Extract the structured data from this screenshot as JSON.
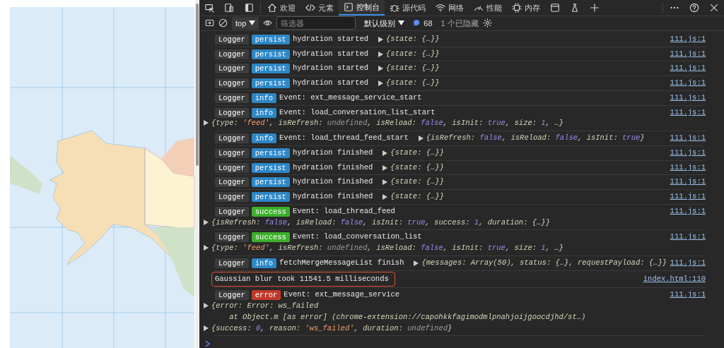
{
  "toolbar": {
    "tools": [
      {
        "kind": "inspect"
      },
      {
        "kind": "device"
      },
      {
        "kind": "dock"
      }
    ],
    "tabs": [
      {
        "kind": "home",
        "label": "欢迎",
        "selected": false
      },
      {
        "kind": "code",
        "label": "元素",
        "selected": false
      },
      {
        "kind": "console",
        "label": "控制台",
        "selected": true
      },
      {
        "kind": "bug",
        "label": "源代码",
        "selected": false
      },
      {
        "kind": "wifi",
        "label": "网络",
        "selected": false
      },
      {
        "kind": "gauge",
        "label": "性能",
        "selected": false
      },
      {
        "kind": "chip",
        "label": "内存",
        "selected": false
      },
      {
        "kind": "window",
        "selected": false
      },
      {
        "kind": "flask",
        "selected": false
      },
      {
        "kind": "plus",
        "selected": false
      }
    ],
    "actions": [
      {
        "kind": "more"
      },
      {
        "kind": "help"
      },
      {
        "kind": "close"
      }
    ]
  },
  "filter_bar": {
    "context": "top",
    "filter_placeholder": "筛选器",
    "level": "默认级别",
    "message_count": "68",
    "hidden": "1 个已隐藏"
  },
  "console": {
    "entries": [
      {
        "badges": [
          {
            "text": "Logger",
            "color": "#3c3c3c"
          },
          {
            "text": "persist",
            "color": "#2d87c6"
          }
        ],
        "message": "hydration started",
        "preview": [
          {
            "text": "{state: {…}}",
            "kind": "key"
          }
        ],
        "source": "111.js:1"
      },
      {
        "badges": [
          {
            "text": "Logger",
            "color": "#3c3c3c"
          },
          {
            "text": "persist",
            "color": "#2d87c6"
          }
        ],
        "message": "hydration started",
        "preview": [
          {
            "text": "{state: {…}}",
            "kind": "key"
          }
        ],
        "source": "111.js:1"
      },
      {
        "badges": [
          {
            "text": "Logger",
            "color": "#3c3c3c"
          },
          {
            "text": "persist",
            "color": "#2d87c6"
          }
        ],
        "message": "hydration started",
        "preview": [
          {
            "text": "{state: {…}}",
            "kind": "key"
          }
        ],
        "source": "111.js:1"
      },
      {
        "badges": [
          {
            "text": "Logger",
            "color": "#3c3c3c"
          },
          {
            "text": "persist",
            "color": "#2d87c6"
          }
        ],
        "message": "hydration started",
        "preview": [
          {
            "text": "{state: {…}}",
            "kind": "key"
          }
        ],
        "source": "111.js:1"
      },
      {
        "badges": [
          {
            "text": "Logger",
            "color": "#3c3c3c"
          },
          {
            "text": "info",
            "color": "#2d87c6"
          }
        ],
        "message": "Event: ext_message_service_start",
        "source": "111.js:1"
      },
      {
        "badges": [
          {
            "text": "Logger",
            "color": "#3c3c3c"
          },
          {
            "text": "info",
            "color": "#2d87c6"
          }
        ],
        "message": "Event: load_conversation_list_start",
        "details": [
          [
            [
              {
                "text": "{type: ",
                "kind": "key"
              },
              {
                "text": "'feed'",
                "kind": "string"
              },
              {
                "text": ", isRefresh: ",
                "kind": "key"
              },
              {
                "text": "undefined",
                "kind": "undef"
              },
              {
                "text": ", isReload: ",
                "kind": "key"
              },
              {
                "text": "false",
                "kind": "literal"
              },
              {
                "text": ", isInit: ",
                "kind": "key"
              },
              {
                "text": "true",
                "kind": "literal"
              },
              {
                "text": ", size: ",
                "kind": "key"
              },
              {
                "text": "1",
                "kind": "literal"
              },
              {
                "text": ", …}",
                "kind": "key"
              }
            ]
          ]
        ],
        "source": "111.js:1"
      },
      {
        "badges": [
          {
            "text": "Logger",
            "color": "#3c3c3c"
          },
          {
            "text": "info",
            "color": "#2d87c6"
          }
        ],
        "message": "Event: load_thread_feed_start",
        "preview": [
          {
            "text": "{isRefresh: ",
            "kind": "key"
          },
          {
            "text": "false",
            "kind": "literal"
          },
          {
            "text": ", isReload: ",
            "kind": "key"
          },
          {
            "text": "false",
            "kind": "literal"
          },
          {
            "text": ", isInit: ",
            "kind": "key"
          },
          {
            "text": "true",
            "kind": "literal"
          },
          {
            "text": "}",
            "kind": "key"
          }
        ],
        "source": "111.js:1"
      },
      {
        "badges": [
          {
            "text": "Logger",
            "color": "#3c3c3c"
          },
          {
            "text": "persist",
            "color": "#2d87c6"
          }
        ],
        "message": "hydration finished",
        "preview": [
          {
            "text": "{state: {…}}",
            "kind": "key"
          }
        ],
        "source": "111.js:1"
      },
      {
        "badges": [
          {
            "text": "Logger",
            "color": "#3c3c3c"
          },
          {
            "text": "persist",
            "color": "#2d87c6"
          }
        ],
        "message": "hydration finished",
        "preview": [
          {
            "text": "{state: {…}}",
            "kind": "key"
          }
        ],
        "source": "111.js:1"
      },
      {
        "badges": [
          {
            "text": "Logger",
            "color": "#3c3c3c"
          },
          {
            "text": "persist",
            "color": "#2d87c6"
          }
        ],
        "message": "hydration finished",
        "preview": [
          {
            "text": "{state: {…}}",
            "kind": "key"
          }
        ],
        "source": "111.js:1"
      },
      {
        "badges": [
          {
            "text": "Logger",
            "color": "#3c3c3c"
          },
          {
            "text": "persist",
            "color": "#2d87c6"
          }
        ],
        "message": "hydration finished",
        "preview": [
          {
            "text": "{state: {…}}",
            "kind": "key"
          }
        ],
        "source": "111.js:1"
      },
      {
        "badges": [
          {
            "text": "Logger",
            "color": "#3c3c3c"
          },
          {
            "text": "success",
            "color": "#3daf2c"
          }
        ],
        "message": "Event: load_thread_feed",
        "details": [
          [
            [
              {
                "text": "{isRefresh: ",
                "kind": "key"
              },
              {
                "text": "false",
                "kind": "literal"
              },
              {
                "text": ", isReload: ",
                "kind": "key"
              },
              {
                "text": "false",
                "kind": "literal"
              },
              {
                "text": ", isInit: ",
                "kind": "key"
              },
              {
                "text": "true",
                "kind": "literal"
              },
              {
                "text": ", success: ",
                "kind": "key"
              },
              {
                "text": "1",
                "kind": "literal"
              },
              {
                "text": ", duration: {…}}",
                "kind": "key"
              }
            ]
          ]
        ],
        "source": "111.js:1"
      },
      {
        "badges": [
          {
            "text": "Logger",
            "color": "#3c3c3c"
          },
          {
            "text": "success",
            "color": "#3daf2c"
          }
        ],
        "message": "Event: load_conversation_list",
        "details": [
          [
            [
              {
                "text": "{type: ",
                "kind": "key"
              },
              {
                "text": "'feed'",
                "kind": "string"
              },
              {
                "text": ", isRefresh: ",
                "kind": "key"
              },
              {
                "text": "undefined",
                "kind": "undef"
              },
              {
                "text": ", isReload: ",
                "kind": "key"
              },
              {
                "text": "false",
                "kind": "literal"
              },
              {
                "text": ", isInit: ",
                "kind": "key"
              },
              {
                "text": "true",
                "kind": "literal"
              },
              {
                "text": ", size: ",
                "kind": "key"
              },
              {
                "text": "1",
                "kind": "literal"
              },
              {
                "text": ", …}",
                "kind": "key"
              }
            ]
          ]
        ],
        "source": "111.js:1"
      },
      {
        "badges": [
          {
            "text": "Logger",
            "color": "#3c3c3c"
          },
          {
            "text": "info",
            "color": "#2d87c6"
          }
        ],
        "message": "fetchMergeMessageList finish",
        "preview": [
          {
            "text": "{messages: Array(50), status: {…}, requestPayload: {…}}",
            "kind": "key"
          }
        ],
        "source": "111.js:1"
      },
      {
        "message": "Gaussian blur took 11541.5 milliseconds",
        "source": "index.html:110",
        "highlighted": true
      },
      {
        "badges": [
          {
            "text": "Logger",
            "color": "#3c3c3c"
          },
          {
            "text": "error",
            "color": "#c0392b"
          }
        ],
        "message": "Event: ext_message_service",
        "details": [
          [
            [
              {
                "text": "{error: Error: ws_failed",
                "kind": "key"
              }
            ],
            [
              {
                "text": "    at Object.m [as error] (chrome-extension://capohkkfagimodmlpnahjoijgoocdjhd/st…)",
                "kind": "key"
              }
            ]
          ],
          [
            [
              {
                "text": "{success: ",
                "kind": "key"
              },
              {
                "text": "0",
                "kind": "literal"
              },
              {
                "text": ", reason: ",
                "kind": "key"
              },
              {
                "text": "'ws_failed'",
                "kind": "string"
              },
              {
                "text": ", duration: ",
                "kind": "key"
              },
              {
                "text": "undefined",
                "kind": "undef"
              },
              {
                "text": "}",
                "kind": "key"
              }
            ]
          ]
        ],
        "source": "111.js:1"
      }
    ]
  }
}
